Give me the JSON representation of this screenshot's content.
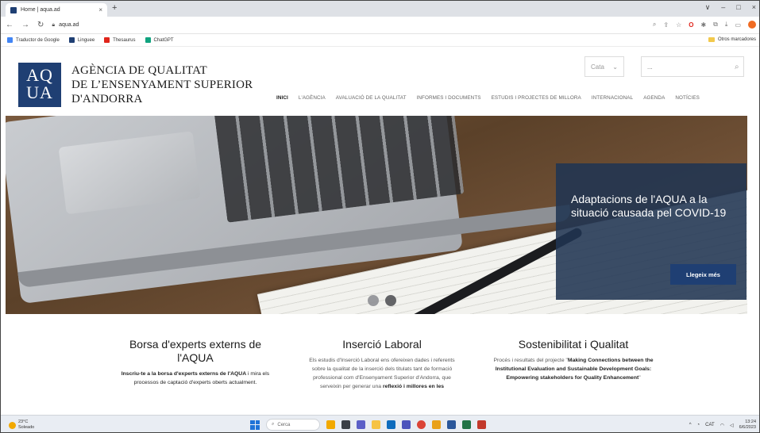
{
  "browser": {
    "tab_title": "Home | aqua.ad",
    "tab_close": "×",
    "new_tab": "+",
    "window_controls": [
      "∨",
      "–",
      "□",
      "×"
    ],
    "url": "aqua.ad",
    "bookmarks": [
      {
        "label": "Traductor de Google",
        "color": "#4285f4"
      },
      {
        "label": "Linguee",
        "color": "#1f3f73"
      },
      {
        "label": "Thesaurus",
        "color": "#e0251b"
      },
      {
        "label": "ChatGPT",
        "color": "#10a37f"
      }
    ],
    "other_bookmarks": "Otros marcadores"
  },
  "header": {
    "logo": {
      "line1": "AQ",
      "line2": "UA"
    },
    "org_name": [
      "AGÈNCIA DE QUALITAT",
      "DE L’ENSENYAMENT SUPERIOR",
      "D'ANDORRA"
    ],
    "language": "Cata",
    "search_placeholder": "..."
  },
  "nav": [
    {
      "label": "INICI",
      "active": true
    },
    {
      "label": "L'AGÈNCIA"
    },
    {
      "label": "AVALUACIÓ DE LA QUALITAT"
    },
    {
      "label": "INFORMES I DOCUMENTS"
    },
    {
      "label": "ESTUDIS I PROJECTES DE MILLORA"
    },
    {
      "label": "INTERNACIONAL"
    },
    {
      "label": "AGENDA"
    },
    {
      "label": "NOTÍCIES"
    }
  ],
  "hero": {
    "caption": "Adaptacions de l'AQUA a la situació causada pel COVID-19",
    "button_label": "Llegeix més"
  },
  "features": [
    {
      "title": "Borsa d'experts externs de l'AQUA",
      "text_bold": "Inscriu-te a la borsa d'experts externs de l'AQUA",
      "text": " i mira els processos de captació d'experts oberts actualment."
    },
    {
      "title": "Inserció Laboral",
      "text": "Els estudis d'Inserció Laboral ens ofereixen dades i referents sobre la qualitat de la inserció dels titulats tant de formació professional com d'Ensenyament Superior d'Andorra, que serveixin per generar una ",
      "text_bold": "reflexió i millores en les"
    },
    {
      "title": "Sostenibilitat i Qualitat",
      "text": "Procés i resultats del projecte \"",
      "text_bold": "Making Connections between the Institutional Evaluation and Sustainable Development Goals: Empowering stakeholders for Quality Enhancement",
      "text_end": "\""
    }
  ],
  "taskbar": {
    "weather_temp": "23°C",
    "weather_desc": "Soleado",
    "search_label": "Cerca",
    "language": "CAT",
    "time": "13:24",
    "date": "6/6/2023"
  }
}
